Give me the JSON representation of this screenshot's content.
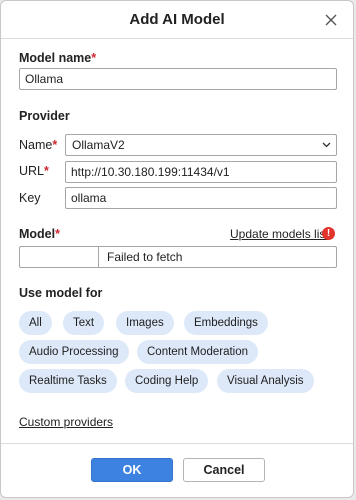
{
  "dialog": {
    "title": "Add AI Model"
  },
  "model_name": {
    "label": "Model name",
    "required_mark": "*",
    "value": "Ollama"
  },
  "provider": {
    "section_label": "Provider",
    "name_label": "Name",
    "name_required_mark": "*",
    "name_value": "OllamaV2",
    "url_label": "URL",
    "url_required_mark": "*",
    "url_value": "http://10.30.180.199:11434/v1",
    "key_label": "Key",
    "key_value": "ollama"
  },
  "model": {
    "label": "Model",
    "required_mark": "*",
    "update_link": "Update models list",
    "error_icon": "!",
    "value": "",
    "status": "Failed to fetch"
  },
  "use_model_for": {
    "label": "Use model for",
    "chips": [
      "All",
      "Text",
      "Images",
      "Embeddings",
      "Audio Processing",
      "Content Moderation",
      "Realtime Tasks",
      "Coding Help",
      "Visual Analysis"
    ]
  },
  "custom_providers_link": "Custom providers",
  "buttons": {
    "ok": "OK",
    "cancel": "Cancel"
  },
  "colors": {
    "primary": "#3d82e0",
    "chip_bg": "#dde8f8",
    "required": "#d0282e",
    "error": "#e2342d"
  }
}
